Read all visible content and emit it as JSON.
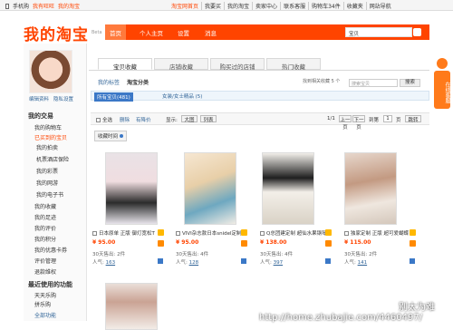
{
  "topbar": {
    "left": [
      "手机购",
      "我有旺旺",
      "我的淘宝"
    ],
    "items": [
      "淘宝网首页",
      "我要买",
      "我的淘宝",
      "卖家中心",
      "联系客服",
      "购物车34件",
      "收藏夹",
      "网站导航"
    ]
  },
  "header": {
    "logo": "我的淘宝",
    "beta": "Beta",
    "nav": [
      "首页",
      "个人主页",
      "设置",
      "消息"
    ],
    "search_value": "宝贝"
  },
  "sidebar": {
    "links": [
      "编辑资料",
      "隐私设置"
    ],
    "sections": [
      {
        "title": "我的交易",
        "items": [
          "我的购物车",
          "已买到的宝贝",
          "我的拍卖",
          "机票酒店保险",
          "我的彩票",
          "我的网游",
          "我的电子书",
          "我的收藏",
          "我的足迹",
          "我的评价",
          "我的积分",
          "我的优惠卡券",
          "评价管理",
          "退款维权"
        ]
      },
      {
        "title": "最近使用的功能",
        "items": [
          "天天乐购",
          "拼乐购",
          "全部功能"
        ]
      }
    ]
  },
  "tabs": [
    "宝贝收藏",
    "店铺收藏",
    "购买过的店铺",
    "热门收藏"
  ],
  "subnav": {
    "label1": "我的标签",
    "label2": "淘宝分类",
    "hint": "找到相关收藏 5 个",
    "search_placeholder": "搜索宝贝",
    "search_btn": "搜索"
  },
  "filters": {
    "all": "所有宝贝(481)",
    "second": "女装/女士精品 (5)"
  },
  "toolbar": {
    "select_all": "全选",
    "delete": "删除",
    "share": "有降价",
    "show_label": "显示:",
    "big": "大图",
    "list": "列表",
    "page": "1/1",
    "prev": "上一页",
    "next": "下一页",
    "goto_label": "到第",
    "goto_value": "1",
    "goto_unit": "页",
    "goto_btn": "跳转"
  },
  "tag_filter": "收藏时间",
  "items": [
    {
      "name": "日本原单 正版 御灯宽松T",
      "price": "¥ 95.00",
      "fav": "30天售出: 2件",
      "pop_label": "人气: ",
      "pop": "163"
    },
    {
      "name": "VIVI杂志款日本snidel定制",
      "price": "¥ 95.00",
      "fav": "30天售出: 4件",
      "pop_label": "人气: ",
      "pop": "128"
    },
    {
      "name": "Q总团建定制 超仙水果钢琴裙",
      "price": "¥ 138.00",
      "fav": "30天售出: 4件",
      "pop_label": "人气: ",
      "pop": "397"
    },
    {
      "name": "独家定制 正版 超可爱蝴蝶",
      "price": "¥ 115.00",
      "fav": "30天售出: 2件",
      "pop_label": "人气: ",
      "pop": "141"
    },
    {
      "name": "",
      "price": "",
      "fav": "",
      "pop_label": "",
      "pop": ""
    }
  ],
  "float": {
    "label": "在线客服"
  },
  "watermark": {
    "line1": "别太为难",
    "line2": "http://home.zhubajie.com/4460497/"
  },
  "colors": {
    "accent": "#ff4400",
    "link": "#336699",
    "filter_active": "#3b78c7"
  }
}
